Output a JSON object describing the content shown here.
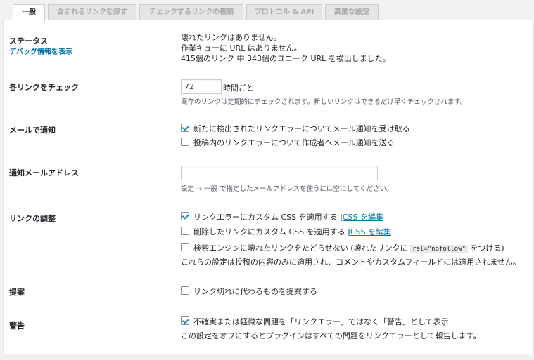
{
  "tabs": [
    {
      "label": "一般"
    },
    {
      "label": "含まれるリンクを探す"
    },
    {
      "label": "チェックするリンクの種類"
    },
    {
      "label": "プロトコル & API"
    },
    {
      "label": "高度な設定"
    }
  ],
  "status": {
    "label": "ステータス",
    "debug_link": "デバッグ情報を表示",
    "line1": "壊れたリンクはありません。",
    "line2": "作業キューに URL はありません。",
    "line3": "415個のリンク 中 343個のユニーク URL を検出しました。"
  },
  "check_each": {
    "label": "各リンクをチェック",
    "value": "72",
    "unit": "時間ごと",
    "desc": "既存のリンクは定期的にチェックされます。新しいリンクはできるだけ早くチェックされます。"
  },
  "email_notify": {
    "label": "メールで通知",
    "opt1": "新たに検出されたリンクエラーについてメール通知を受け取る",
    "opt2": "投稿内のリンクエラーについて作成者へメール通知を送る"
  },
  "notify_address": {
    "label": "通知メールアドレス",
    "value": "",
    "desc": "設定 → 一般 で指定したメールアドレスを使うには空にしてください。"
  },
  "link_tweaks": {
    "label": "リンクの調整",
    "opt1": "リンクエラーにカスタム CSS を適用する",
    "opt2": "削除したリンクにカスタム CSS を適用する",
    "separator": "|",
    "edit_css": "CSS を編集",
    "opt3_pre": "検索エンジンに壊れたリンクをたどらせない (壊れたリンクに",
    "opt3_code": "rel=\"nofollow\"",
    "opt3_post": "をつける)",
    "note": "これらの設定は投稿の内容のみに適用され、コメントやカスタムフィールドには適用されません。"
  },
  "suggest": {
    "label": "提案",
    "opt": "リンク切れに代わるものを提案する"
  },
  "warning": {
    "label": "警告",
    "opt": "不確実または軽微な問題を「リンクエラー」ではなく「警告」として表示",
    "desc": "この設定をオフにするとプラグインはすべての問題をリンクエラーとして報告します。"
  },
  "colors": {
    "accent": "#0073aa",
    "checkmark": "#1e8cbe",
    "panel_bg": "#ffffff",
    "page_bg": "#f1f1f1"
  }
}
